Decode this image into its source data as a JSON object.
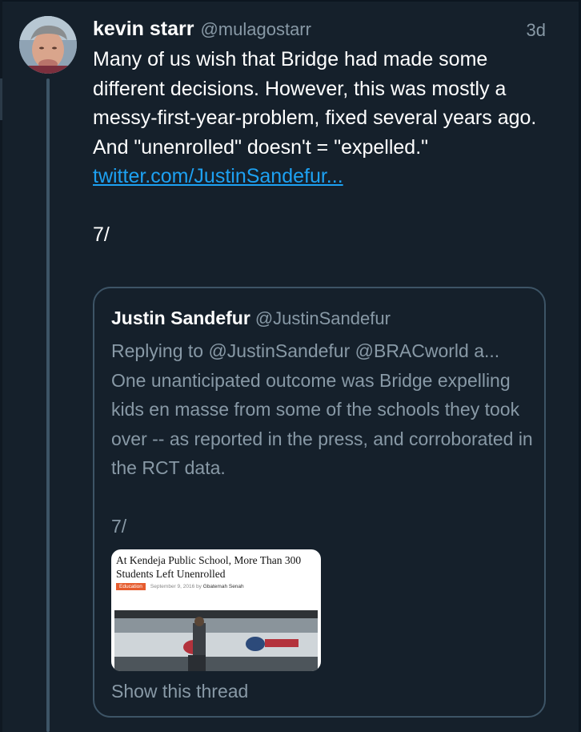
{
  "tweet": {
    "display_name": "kevin starr",
    "handle": "@mulagostarr",
    "time": "3d",
    "text": "Many of us wish that Bridge had made some different decisions. However, this was mostly a messy-first-year-problem, fixed several years ago. And \"unenrolled\" doesn't = \"expelled.\"",
    "link": "twitter.com/JustinSandefur...",
    "numbering": "7/"
  },
  "quote": {
    "display_name": "Justin Sandefur",
    "handle": "@JustinSandefur",
    "replying": "Replying to @JustinSandefur @BRACworld a...",
    "text": "One unanticipated outcome was Bridge expelling kids en masse from some of the schools they took over -- as reported in the press, and corroborated in the RCT data.",
    "numbering": "7/",
    "article": {
      "headline": "At Kendeja Public School, More Than 300 Students Left Unenrolled",
      "tag": "Education",
      "date": "September 9, 2016 by",
      "author": "Gbatemah Senah"
    },
    "show_thread": "Show this thread"
  },
  "icons": {
    "avatar": "user-avatar-photo"
  },
  "colors": {
    "background": "#15202b",
    "text": "#ffffff",
    "secondary_text": "#8899a6",
    "link": "#1da1f2",
    "border": "#3d5466",
    "tag": "#e65c2e"
  }
}
